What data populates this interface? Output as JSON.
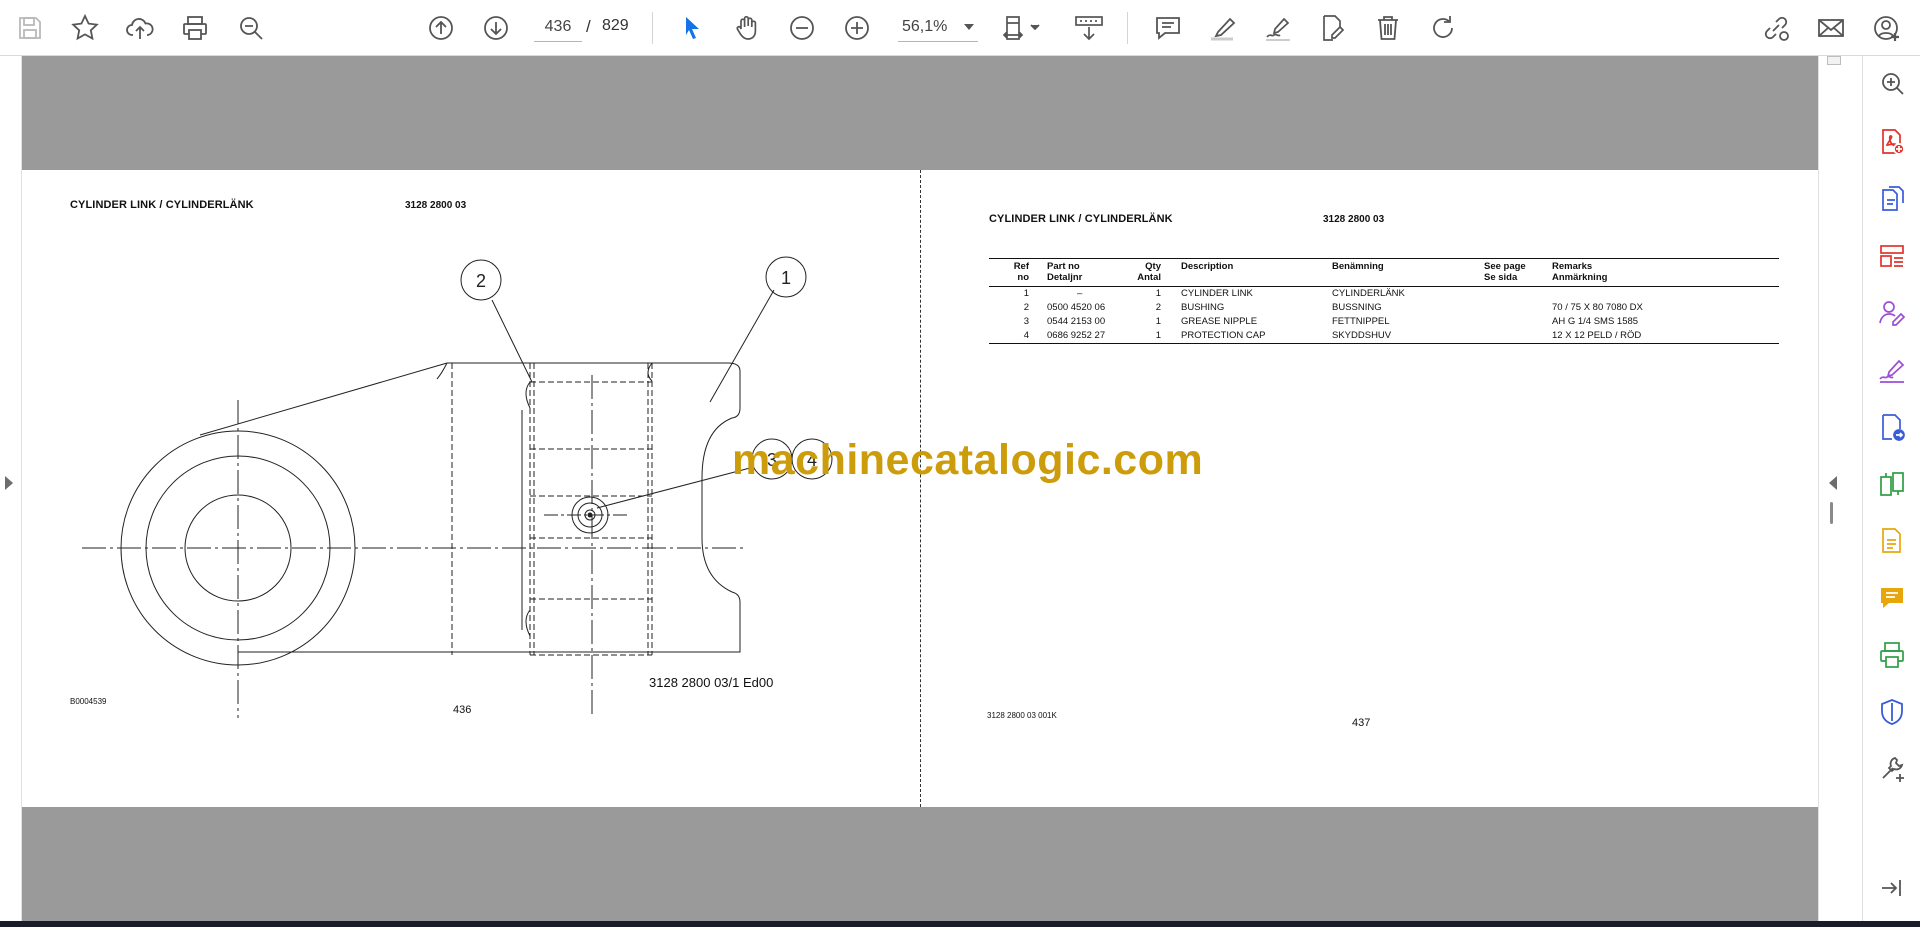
{
  "toolbar": {
    "current_page": "436",
    "page_separator": "/",
    "total_pages": "829",
    "zoom": "56,1%",
    "icons": [
      "save-icon",
      "bookmark-star-icon",
      "cloud-upload-icon",
      "print-icon",
      "zoom-search-icon",
      "page-up-icon",
      "page-down-icon",
      "cursor-select-icon",
      "hand-pan-icon",
      "zoom-out-icon",
      "zoom-in-icon",
      "page-fit-icon",
      "scroll-mode-icon",
      "comment-icon",
      "highlighter-icon",
      "sign-pen-icon",
      "fill-sign-icon",
      "delete-icon",
      "rotate-icon",
      "share-link-icon",
      "email-icon",
      "account-add-icon"
    ],
    "accent_color": "#1473e6"
  },
  "tool_panel": {
    "icons": [
      "zoom-search-icon",
      "create-pdf-icon",
      "export-pdf-icon",
      "organize-pages-icon",
      "request-signature-icon",
      "fill-sign-icon",
      "send-for-review-icon",
      "compare-files-icon",
      "edit-pdf-icon",
      "comment-icon",
      "print-production-icon",
      "protect-icon",
      "more-tools-icon",
      "collapse-panel-icon"
    ],
    "colors": {
      "red": "#e0342c",
      "blue": "#3a5cd9",
      "purple": "#9c4fd6",
      "green": "#2f9e44",
      "yellow": "#e8a60d",
      "slate": "#5b6b8a"
    }
  },
  "document": {
    "left_page": {
      "title": "CYLINDER LINK / CYLINDERLÄNK",
      "part_number": "3128 2800 03",
      "callout_1": "1",
      "callout_2": "2",
      "callout_3": "3",
      "callout_4": "4",
      "drawing_ref": "3128 2800 03/1  Ed00",
      "figure_code": "B0004539",
      "page_number": "436"
    },
    "right_page": {
      "title": "CYLINDER LINK / CYLINDERLÄNK",
      "part_number": "3128 2800 03",
      "table": {
        "headers": {
          "ref": [
            "Ref",
            "no"
          ],
          "part": [
            "Part no",
            "Detaljnr"
          ],
          "qty": [
            "Qty",
            "Antal"
          ],
          "desc": [
            "Description"
          ],
          "ben": [
            "Benämning"
          ],
          "see": [
            "See page",
            "Se sida"
          ],
          "rem": [
            "Remarks",
            "Anmärkning"
          ]
        },
        "rows": [
          {
            "ref": "1",
            "part": "–",
            "qty": "1",
            "desc": "CYLINDER LINK",
            "ben": "CYLINDERLÄNK",
            "see": "",
            "rem": ""
          },
          {
            "ref": "2",
            "part": "0500 4520 06",
            "qty": "2",
            "desc": "BUSHING",
            "ben": "BUSSNING",
            "see": "",
            "rem": "70 / 75 X 80 7080 DX"
          },
          {
            "ref": "3",
            "part": "0544 2153 00",
            "qty": "1",
            "desc": "GREASE NIPPLE",
            "ben": "FETTNIPPEL",
            "see": "",
            "rem": "AH G 1/4 SMS 1585"
          },
          {
            "ref": "4",
            "part": "0686 9252 27",
            "qty": "1",
            "desc": "PROTECTION CAP",
            "ben": "SKYDDSHUV",
            "see": "",
            "rem": "12 X 12 PELD / RÖD"
          }
        ]
      },
      "footer_code": "3128 2800 03  001K",
      "page_number": "437"
    },
    "watermark": "machinecatalogic.com",
    "watermark_color": "#cc9c0a"
  }
}
